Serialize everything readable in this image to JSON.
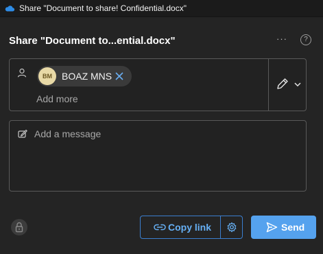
{
  "window": {
    "title": "Share \"Document to share! Confidential.docx\""
  },
  "dialog": {
    "heading": "Share \"Document to...ential.docx\"",
    "more_options_label": "···",
    "help_label": "?"
  },
  "recipients": {
    "chips": [
      {
        "initials": "BM",
        "name": "BOAZ MNS"
      }
    ],
    "add_more_placeholder": "Add more"
  },
  "message": {
    "placeholder": "Add a message"
  },
  "actions": {
    "copy_link_label": "Copy link",
    "send_label": "Send"
  },
  "colors": {
    "background": "#242424",
    "accent": "#55a2ee",
    "link_text": "#66b0f5",
    "avatar_bg": "#e8d9a6"
  },
  "icons": [
    "onedrive-cloud-icon",
    "more-icon",
    "help-icon",
    "person-icon",
    "close-icon",
    "pencil-icon",
    "chevron-down-icon",
    "compose-icon",
    "lock-icon",
    "link-icon",
    "gear-icon",
    "send-icon"
  ]
}
